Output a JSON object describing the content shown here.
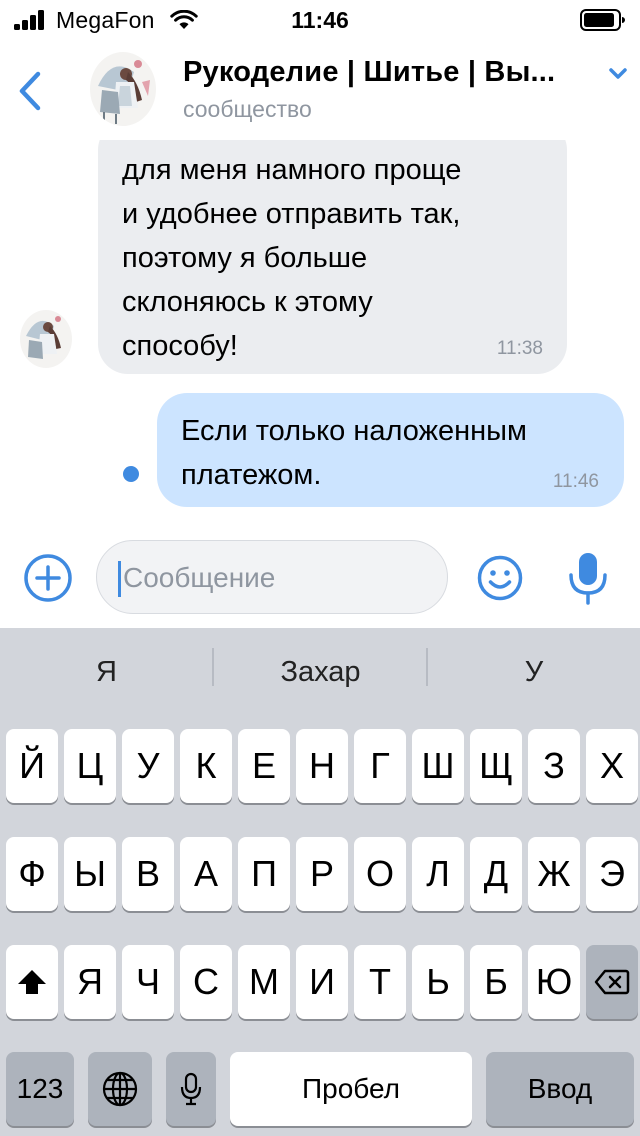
{
  "status_bar": {
    "carrier": "MegaFon",
    "time": "11:46"
  },
  "header": {
    "title": "Рукоделие | Шитье | Вы...",
    "subtitle": "сообщество",
    "back_icon": "chevron-left-icon",
    "menu_icon": "chevron-down-icon"
  },
  "messages": [
    {
      "direction": "incoming",
      "lines": [
        "для меня намного проще",
        "и удобнее отправить так,",
        "поэтому я больше",
        "склоняюсь к этому",
        "способу!"
      ],
      "time": "11:38"
    },
    {
      "direction": "outgoing",
      "lines": [
        "Если только наложенным",
        "платежом."
      ],
      "time": "11:46",
      "unread": true
    }
  ],
  "composer": {
    "placeholder": "Сообщение",
    "attach_icon": "plus-circle-icon",
    "emoji_icon": "smile-icon",
    "mic_icon": "microphone-icon"
  },
  "keyboard": {
    "suggestions": [
      "Я",
      "Захар",
      "У"
    ],
    "row1": [
      "Й",
      "Ц",
      "У",
      "К",
      "Е",
      "Н",
      "Г",
      "Ш",
      "Щ",
      "З",
      "Х"
    ],
    "row2": [
      "Ф",
      "Ы",
      "В",
      "А",
      "П",
      "Р",
      "О",
      "Л",
      "Д",
      "Ж",
      "Э"
    ],
    "row3": [
      "Я",
      "Ч",
      "С",
      "М",
      "И",
      "Т",
      "Ь",
      "Б",
      "Ю"
    ],
    "numbers_label": "123",
    "space_label": "Пробел",
    "return_label": "Ввод"
  },
  "colors": {
    "accent": "#3f8ae0",
    "incoming_bubble": "#ebedf0",
    "outgoing_bubble": "#cce4ff",
    "secondary_text": "#8f96a0",
    "keyboard_bg": "#d2d5db"
  }
}
